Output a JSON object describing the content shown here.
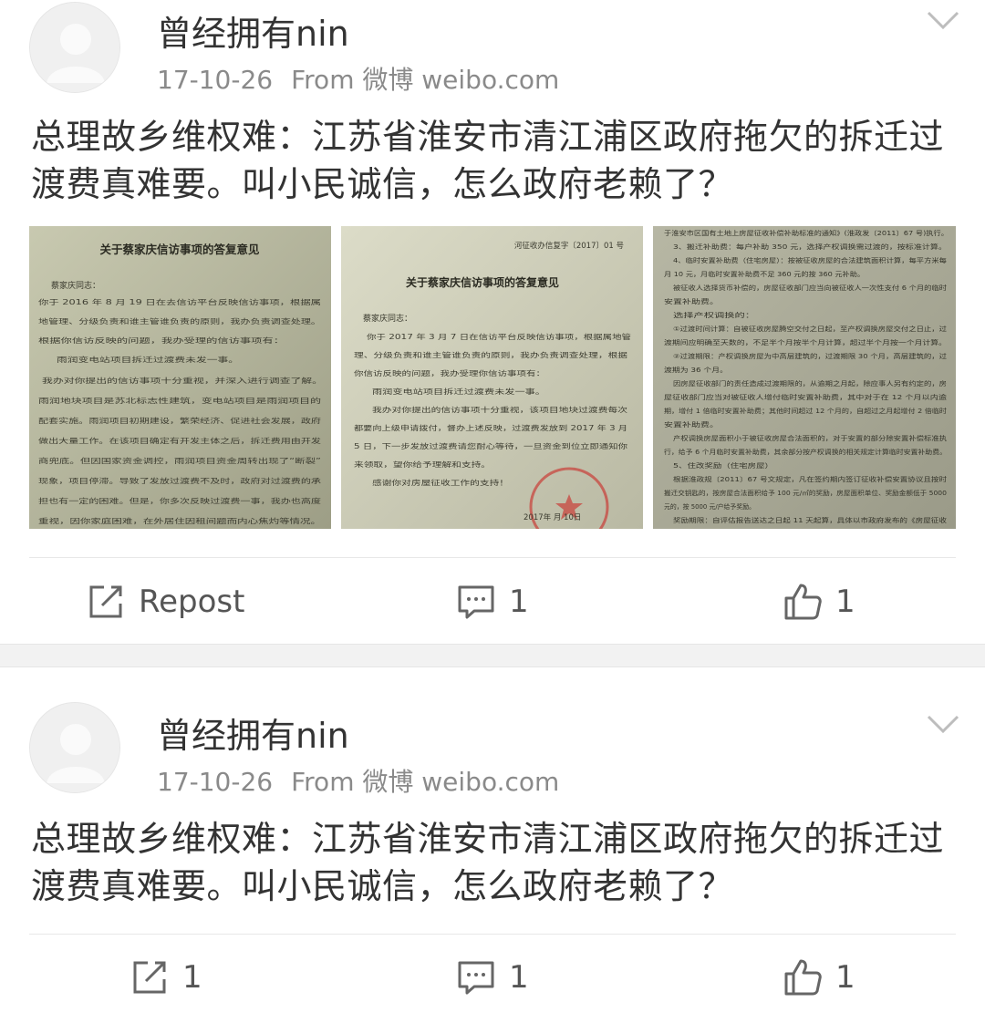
{
  "posts": [
    {
      "username": "曾经拥有nin",
      "date": "17-10-26",
      "source": "From 微博 weibo.com",
      "text": "总理故乡维权难：江苏省淮安市清江浦区政府拖欠的拆迁过渡费真难要。叫小民诚信，怎么政府老赖了？",
      "images": [
        {
          "title": "关于蔡家庆信访事项的答复意见",
          "salutation": "蔡家庆同志：",
          "lines": [
            "你于 2016 年 8 月 19 日在去信访平台反映信访事项，根据属",
            "地管理、分级负责和谁主管谁负责的原则，我办负责调查处理。",
            "根据你信访反映的问题，我办受理的信访事项有：",
            "雨润变电站项目拆迁过渡费未发一事。",
            "我办对你提出的信访事项十分重视，并深入进行调查了解。",
            "雨润地块项目是苏北标志性建筑，变电站项目是雨润项目的",
            "配套实施。雨润项目初期建设，繁荣经济、促进社会发展，政府",
            "做出大量工作。在该项目确定有开发主体之后，拆迁费用由开发",
            "商兜底。但因国家资金调控，雨润项目资金周转出现了“断裂”",
            "现象，项目停滞。导致了发放过渡费不及时，政府对过渡费的承",
            "担也有一定的困难。但是，你多次反映过渡费一事，我办也高度",
            "重视，因你家庭困难，在外居住因租间题而内心焦灼等情况。"
          ]
        },
        {
          "doc_no": "河征收办信复字〔2017〕01 号",
          "title": "关于蔡家庆信访事项的答复意见",
          "salutation": "蔡家庆同志：",
          "lines": [
            "你于 2017 年 3 月 7 日在信访平台反映信访事项，根据属地管",
            "理、分级负责和谁主管谁负责的原则，我办负责调查处理，根据",
            "你信访反映的问题，我办受理你信访事项有：",
            "雨润变电站项目拆迁过渡费未发一事。",
            "我办对你提出的信访事项十分重视，该项目地块过渡费每次",
            "都要向上级申请拨付，督办上述反映，过渡费发放到 2017 年 3 月",
            "5 日，下一步发放过渡费请您耐心等待，一旦资金到位立即通知你",
            "来领取，望你给予理解和支持。",
            "感谢你对房屋征收工作的支持！"
          ],
          "date_line": "2017年 月 10日"
        },
        {
          "lines": [
            "于淮安市区国有土地上房屋征收补偿补助标准的通知》(淮政发〔2011〕67 号)执行。",
            "3、搬迁补助费：每户补助 350 元，选择产权调换需过渡的，按标准计算。",
            "4、临时安置补助费（住宅房屋）：按被征收房屋的合法建筑面积计算，每平方米每",
            "月 10 元，月临时安置补助费不足 360 元的按 360 元补助。",
            "被征收人选择货币补偿的，房屋征收部门应当向被征收人一次性支付 6 个月的临时",
            "安置补助费。",
            "选择产权调换的：",
            "①过渡时间计算：自被征收房屋腾空交付之日起，至产权调换房屋交付之日止，过",
            "渡期间应明确至天数的，不足半个月按半个月计算，超过半个月按一个月计算。",
            "②过渡期限：产权调换房屋为中高层建筑的，过渡期限 30 个月，高层建筑的，过",
            "渡期为 36 个月。",
            "因房屋征收部门的责任造成过渡期限的，从逾期之月起，除应事人另有约定的，房",
            "屋征收部门应当对被征收人增付临时安置补助费，其中对于在 12 个月以内逾",
            "期，增付 1 倍临时安置补助费；其他时间超过 12 个月的，自超过之月起增付 2 倍临时",
            "安置补助费。",
            "产权调换房屋面积小于被征收房屋合法面积的，对于安置的部分除安置补偿标准执",
            "行，给予 6 个月临时安置补助费，其余部分按产权调换的相关规定计算临时安置补助费。",
            "5、住改奖励（住宅房屋）",
            "根据淮政规〔2011〕67 号文规定，凡在签约期内签订征收补偿安置协议且按时",
            "搬迁交钥匙的，按房屋合法面积给予 100 元/㎡的奖励，房屋面积单位、奖励金额低于 5000",
            "元的，按 5000 元/户给予奖励。",
            "奖励期限：自评估报告送达之日起 11 天起算，具体以市政府发布的《房屋征收"
          ]
        }
      ],
      "actions": {
        "repost": "Repost",
        "comment": "1",
        "like": "1"
      }
    },
    {
      "username": "曾经拥有nin",
      "date": "17-10-26",
      "source": "From 微博 weibo.com",
      "text": "总理故乡维权难：江苏省淮安市清江浦区政府拖欠的拆迁过渡费真难要。叫小民诚信，怎么政府老赖了？",
      "actions": {
        "repost": "1",
        "comment": "1",
        "like": "1"
      }
    }
  ],
  "icons": {
    "avatar": "default-avatar",
    "chevron": "chevron-down-icon",
    "repost": "repost-icon",
    "comment": "comment-icon",
    "like": "thumbs-up-icon"
  },
  "colors": {
    "text": "#333333",
    "meta": "#8a8a8a",
    "icon": "#666666",
    "divider": "#e8e8e8",
    "separator": "#f2f2f2"
  }
}
